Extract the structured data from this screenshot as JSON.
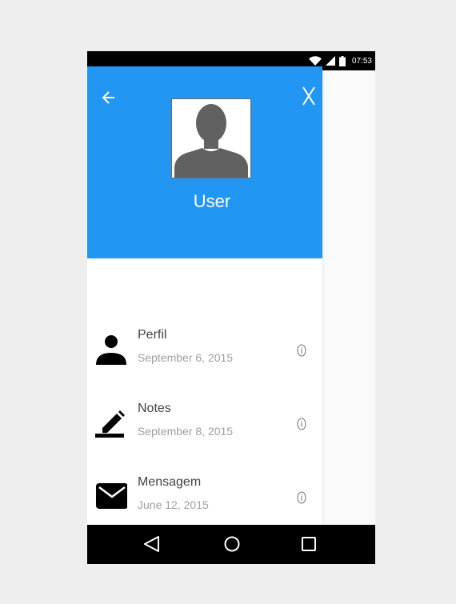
{
  "status_bar": {
    "time": "07:53",
    "icons": [
      "wifi-icon",
      "signal-icon",
      "battery-icon"
    ]
  },
  "header": {
    "user_name": "User",
    "back_icon": "arrow-left-icon",
    "close_label": "X",
    "accent_color": "#2196f3"
  },
  "menu": {
    "items": [
      {
        "title": "Perfil",
        "date": "September 6, 2015",
        "icon": "person-icon"
      },
      {
        "title": "Notes",
        "date": "September 8, 2015",
        "icon": "edit-icon"
      },
      {
        "title": "Mensagem",
        "date": "June 12, 2015",
        "icon": "mail-icon"
      }
    ]
  },
  "nav_bar": {
    "icons": [
      "back-triangle-icon",
      "home-circle-icon",
      "recents-square-icon"
    ]
  }
}
